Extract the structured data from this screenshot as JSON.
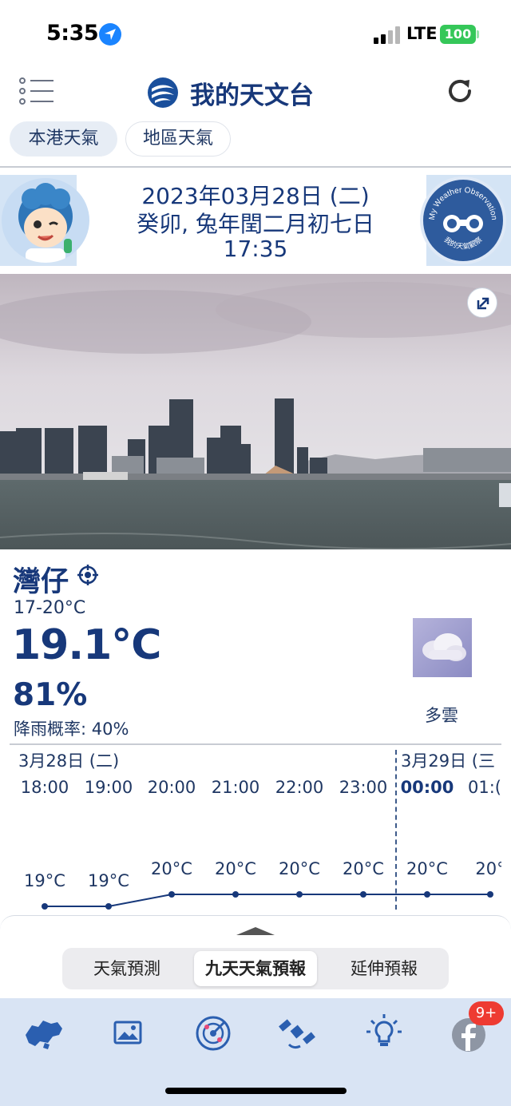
{
  "status_bar": {
    "time": "5:35",
    "network": "LTE",
    "battery": "100"
  },
  "header": {
    "title": "我的天文台",
    "icons": [
      "menu-icon",
      "hko-logo",
      "refresh-icon"
    ]
  },
  "tabs": [
    {
      "label": "本港天氣",
      "active": true
    },
    {
      "label": "地區天氣",
      "active": false
    }
  ],
  "date_panel": {
    "date": "2023年03月28日 (二)",
    "lunar": "癸卯, 兔年閏二月初七日",
    "time": "17:35",
    "badge_text": "My Weather Observation",
    "badge_subtext": "我的天氣觀察"
  },
  "current": {
    "location": "灣仔",
    "temp_range": "17-20°C",
    "temperature": "19.1°C",
    "humidity": "81%",
    "rain_probability": "降雨概率: 40%",
    "condition": "多雲",
    "condition_icon": "cloudy-icon"
  },
  "hourly": {
    "days": [
      "3月28日 (二)",
      "3月29日 (三"
    ],
    "hours": [
      "18:00",
      "19:00",
      "20:00",
      "21:00",
      "22:00",
      "23:00",
      "00:00",
      "01:("
    ],
    "temps": [
      "19°C",
      "19°C",
      "20°C",
      "20°C",
      "20°C",
      "20°C",
      "20°C",
      "20°"
    ],
    "temp_values": [
      19,
      19,
      20,
      20,
      20,
      20,
      20,
      20
    ]
  },
  "sheet": {
    "segments": [
      {
        "label": "天氣預測",
        "active": false
      },
      {
        "label": "九天天氣預報",
        "active": true
      },
      {
        "label": "延伸預報",
        "active": false
      }
    ]
  },
  "bottom_nav": {
    "items": [
      "hk-map-icon",
      "gallery-icon",
      "radar-icon",
      "satellite-icon",
      "tips-bulb-icon",
      "facebook-icon"
    ],
    "badge": "9+"
  },
  "colors": {
    "brand": "#17387a",
    "panel": "#d4e4f5",
    "nav": "#d9e4f4",
    "badge": "#ee3b32"
  }
}
